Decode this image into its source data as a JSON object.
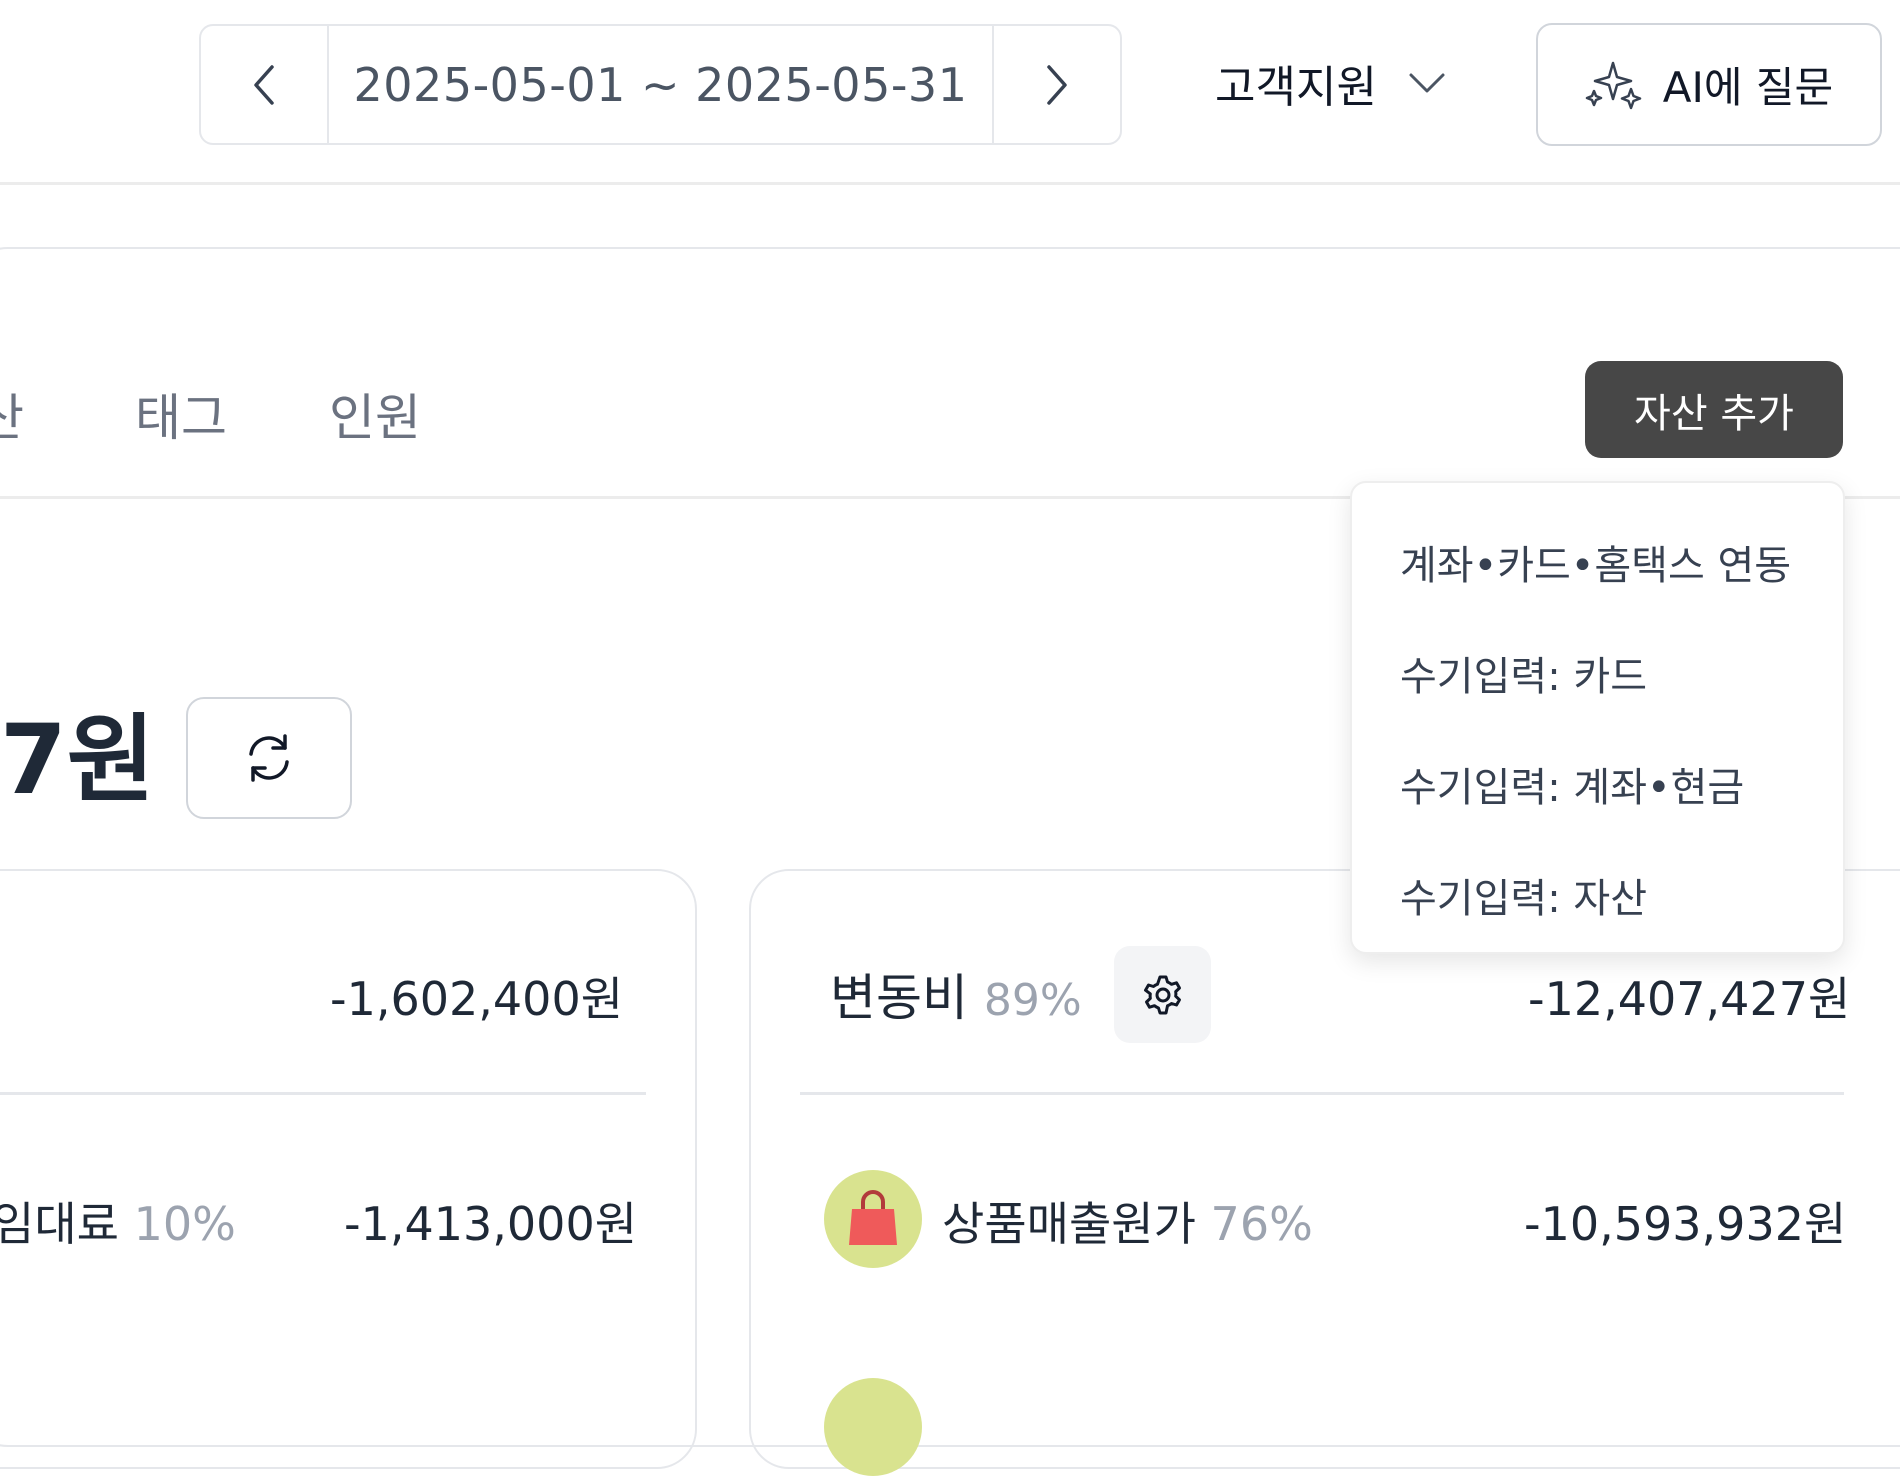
{
  "header": {
    "date_range": "2025-05-01 ~ 2025-05-31",
    "support_label": "고객지원",
    "ai_button_label": "AI에 질문"
  },
  "tabs": [
    {
      "label": "산"
    },
    {
      "label": "태그"
    },
    {
      "label": "인원"
    }
  ],
  "add_asset_button": "자산 추가",
  "dropdown": {
    "items": [
      {
        "label": "계좌•카드•홈택스 연동"
      },
      {
        "label": "수기입력: 카드"
      },
      {
        "label": "수기입력: 계좌•현금"
      },
      {
        "label": "수기입력: 자산"
      }
    ]
  },
  "total": {
    "amount_fragment": "7원"
  },
  "fixed_cost_card": {
    "total_amount": "-1,602,400원",
    "row": {
      "name": "임대료",
      "percent": "10%",
      "amount": "-1,413,000원"
    }
  },
  "variable_cost_card": {
    "title": "변동비",
    "percent": "89%",
    "total_amount": "-12,407,427원",
    "row": {
      "name": "상품매출원가",
      "percent": "76%",
      "amount": "-10,593,932원"
    }
  },
  "colors": {
    "primary_button": "#474747",
    "avatar_bg": "#d9e38f",
    "bag_icon": "#ef5a5a"
  }
}
